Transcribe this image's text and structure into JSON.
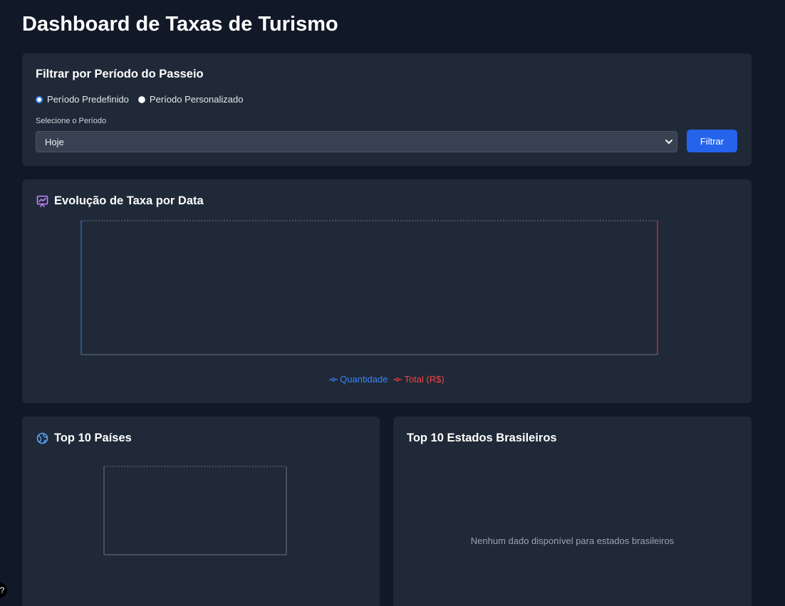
{
  "header": {
    "title": "Dashboard de Taxas de Turismo"
  },
  "filter": {
    "heading": "Filtrar por Período do Passeio",
    "radio_predefined": "Período Predefinido",
    "radio_custom": "Período Personalizado",
    "selected_mode": "predefined",
    "select_label": "Selecione o Período",
    "select_value": "Hoje",
    "button_label": "Filtrar"
  },
  "evolution": {
    "heading": "Evolução de Taxa por Data",
    "icon": "chart-icon",
    "chart_data": {
      "type": "line",
      "series": [
        {
          "name": "Quantidade",
          "values": [],
          "color": "#3b82f6"
        },
        {
          "name": "Total (R$)",
          "values": [],
          "color": "#ef4444"
        }
      ],
      "legend_position": "bottom"
    },
    "legend": {
      "quantidade": "Quantidade",
      "total": "Total (R$)"
    }
  },
  "countries": {
    "heading": "Top 10 Países",
    "icon": "globe-icon",
    "chart_data": {
      "type": "bar",
      "categories": [],
      "values": []
    }
  },
  "states": {
    "heading": "Top 10 Estados Brasileiros",
    "empty_message": "Nenhum dado disponível para estados brasileiros"
  },
  "colors": {
    "background": "#111827",
    "card": "#1f2937",
    "accent": "#2563eb",
    "series_blue": "#3b82f6",
    "series_red": "#ef4444"
  }
}
